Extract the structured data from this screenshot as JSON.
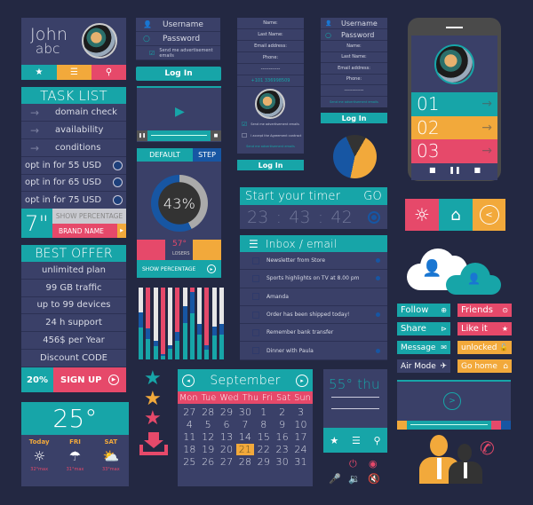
{
  "colors": {
    "background": "#232842",
    "panel": "#3a4068",
    "teal": "#17a5a8",
    "orange": "#f2a93b",
    "red": "#e6496a",
    "blue": "#1756a3"
  },
  "profile": {
    "first": "John",
    "last": "abc",
    "icons": [
      "star-icon",
      "menu-icon",
      "location-pin-icon"
    ]
  },
  "tasks": {
    "title": "TASK LIST",
    "items": [
      "domain check",
      "availability",
      "conditions"
    ],
    "options": [
      "opt in for 55 USD",
      "opt in for 65 USD",
      "opt in for 75 USD"
    ],
    "size": "7\"",
    "show_percentage": "SHOW PERCENTAGE",
    "brand": "BRAND NAME"
  },
  "offer": {
    "title": "BEST OFFER",
    "items": [
      "unlimited plan",
      "99 GB traffic",
      "up to 99 devices",
      "24 h support",
      "456$ per Year",
      "Discount CODE"
    ],
    "discount": "20%",
    "signup": "SIGN UP"
  },
  "weather": {
    "temp": "25°",
    "days": [
      {
        "label": "Today",
        "max": "32°max",
        "icon": "sun-icon"
      },
      {
        "label": "FRI",
        "max": "31°max",
        "icon": "rain-cloud-icon"
      },
      {
        "label": "SAT",
        "max": "33°max",
        "icon": "partly-cloudy-icon"
      }
    ]
  },
  "login1": {
    "username": "Username",
    "password": "Password",
    "checkbox": "Send me advertisement emails",
    "button": "Log In"
  },
  "gauge": {
    "tab_default": "DEFAULT",
    "tab_step": "STEP",
    "percent": "43%",
    "value": 43,
    "temp": "57°",
    "losers": "LOSERS",
    "show_percentage": "SHOW PERCENTAGE"
  },
  "bars": [
    {
      "top": "white",
      "teal": 0.45,
      "blue": 0.2
    },
    {
      "top": "red",
      "teal": 0.28,
      "blue": 0.15
    },
    {
      "top": "white",
      "teal": 0.18,
      "blue": 0.08
    },
    {
      "top": "red",
      "teal": 0.05,
      "blue": 0.02
    },
    {
      "top": "white",
      "teal": 0.15,
      "blue": 0.05
    },
    {
      "top": "red",
      "teal": 0.26,
      "blue": 0.12
    },
    {
      "top": "white",
      "teal": 0.5,
      "blue": 0.24
    },
    {
      "top": "red",
      "teal": 0.64,
      "blue": 0.3
    },
    {
      "top": "white",
      "teal": 0.34,
      "blue": 0.15
    },
    {
      "top": "red",
      "teal": 0.13,
      "blue": 0.07
    },
    {
      "top": "white",
      "teal": 0.33,
      "blue": 0.13
    },
    {
      "top": "white",
      "teal": 0.34,
      "blue": 0.16
    }
  ],
  "form1": {
    "fields": [
      "Name:",
      "Last Name:",
      "Email address:",
      "Phone:",
      "------------",
      "+101 336998509"
    ],
    "check1": "Send me advertisement emails",
    "check2": "I accept the Agreement contract",
    "send": "Send me advertisement emails",
    "button": "Log In"
  },
  "form2": {
    "username": "Username",
    "password": "Password",
    "fields": [
      "Name:",
      "Last Name:",
      "Email address:",
      "Phone:",
      "------------"
    ],
    "send": "Send me advertisement emails",
    "button": "Log In"
  },
  "pie": [
    {
      "color": "#f2a93b",
      "value": 45
    },
    {
      "color": "#1756a3",
      "value": 40
    },
    {
      "color": "#333",
      "value": 15
    }
  ],
  "phone": {
    "items": [
      "01",
      "02",
      "03"
    ]
  },
  "timer": {
    "title": "Start your timer",
    "go": "GO",
    "h": "23",
    "m": "43",
    "s": "42"
  },
  "inbox": {
    "title": "Inbox / email",
    "items": [
      {
        "text": "Newsletter from Store",
        "unread": true
      },
      {
        "text": "Sports highlights on TV at 8.00 pm",
        "unread": true
      },
      {
        "text": "Amanda",
        "unread": false
      },
      {
        "text": "Order has been shipped today!",
        "unread": true
      },
      {
        "text": "Remember bank transfer",
        "unread": false
      },
      {
        "text": "Dinner with Paula",
        "unread": true
      }
    ]
  },
  "buttons": {
    "follow": "Follow",
    "friends": "Friends",
    "share": "Share",
    "like": "Like it",
    "message": "Message",
    "unlocked": "unlocked",
    "airmode": "Air Mode",
    "gohome": "Go home"
  },
  "calendar": {
    "month": "September",
    "weekdays": [
      "Mon",
      "Tue",
      "Wed",
      "Thu",
      "Fri",
      "Sat",
      "Sun"
    ],
    "days": [
      "27",
      "28",
      "29",
      "30",
      "1",
      "2",
      "3",
      "4",
      "5",
      "6",
      "7",
      "8",
      "9",
      "10",
      "11",
      "12",
      "13",
      "14",
      "15",
      "16",
      "17",
      "18",
      "19",
      "20",
      "21",
      "22",
      "23",
      "24",
      "25",
      "26",
      "27",
      "28",
      "29",
      "30",
      "31"
    ],
    "selected": "21"
  },
  "weather2": {
    "text": "55° thu"
  }
}
